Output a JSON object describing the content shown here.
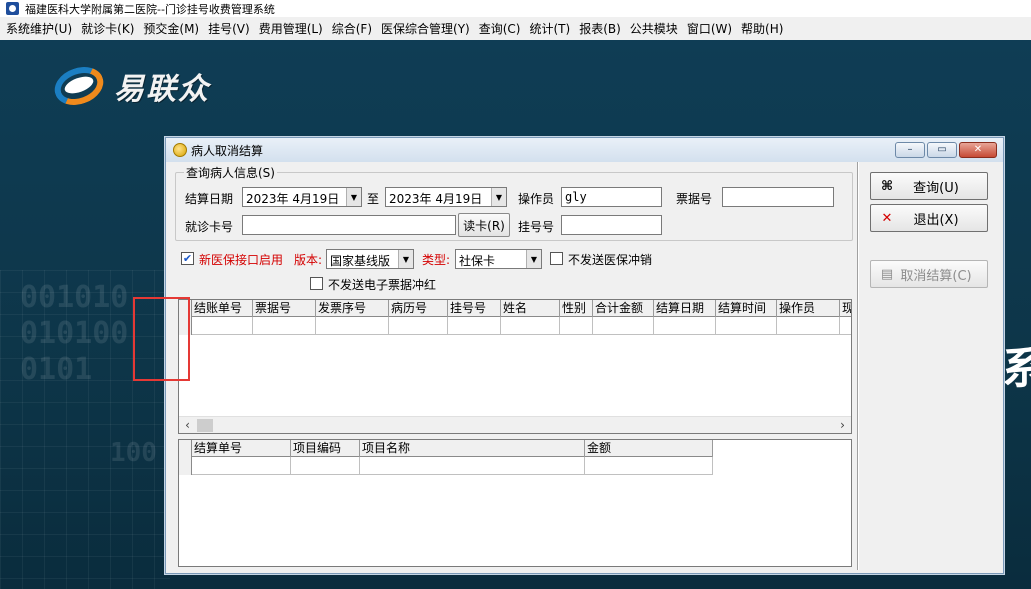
{
  "app": {
    "title": "福建医科大学附属第二医院--门诊挂号收费管理系统"
  },
  "menu": [
    "系统维护(U)",
    "就诊卡(K)",
    "预交金(M)",
    "挂号(V)",
    "费用管理(L)",
    "综合(F)",
    "医保综合管理(Y)",
    "查询(C)",
    "统计(T)",
    "报表(B)",
    "公共模块",
    "窗口(W)",
    "帮助(H)"
  ],
  "background": {
    "logo_text": "易联众",
    "big_char": "系"
  },
  "dialog": {
    "title": "病人取消结算",
    "controls": {
      "minimize": "–",
      "restore": "▭",
      "close": "✕"
    },
    "query_group": {
      "legend": "查询病人信息(S)",
      "settle_date_label": "结算日期",
      "date_from": "2023年 4月19日",
      "to_label": "至",
      "date_to": "2023年 4月19日",
      "operator_label": "操作员",
      "operator_value": "gly",
      "receipt_label": "票据号",
      "receipt_value": "",
      "card_label": "就诊卡号",
      "card_value": "",
      "read_card_button": "读卡(R)",
      "register_label": "挂号号",
      "register_value": ""
    },
    "options": {
      "new_insurance_label": "新医保接口启用",
      "new_insurance_checked": "✔",
      "version_label": "版本:",
      "version_value": "国家基线版",
      "type_label": "类型:",
      "type_value": "社保卡",
      "no_send_insurance_reverse": "不发送医保冲销",
      "no_send_einvoice_reverse": "不发送电子票据冲红"
    },
    "buttons": {
      "query": {
        "icon": "binoculars-icon",
        "label": "查询(U)"
      },
      "exit": {
        "icon": "x-icon",
        "label": "退出(X)"
      },
      "cancel_settle": {
        "icon": "document-icon",
        "label": "取消结算(C)"
      }
    },
    "settle_grid": {
      "columns": [
        "结账单号",
        "票据号",
        "发票序号",
        "病历号",
        "挂号号",
        "姓名",
        "性别",
        "合计金额",
        "结算日期",
        "结算时间",
        "操作员",
        "现"
      ]
    },
    "detail_grid": {
      "columns": [
        "结算单号",
        "项目编码",
        "项目名称",
        "金额"
      ]
    }
  },
  "colors": {
    "desktop": "#0f3a50",
    "highlight": "#e53935",
    "red_label": "#d40000"
  }
}
